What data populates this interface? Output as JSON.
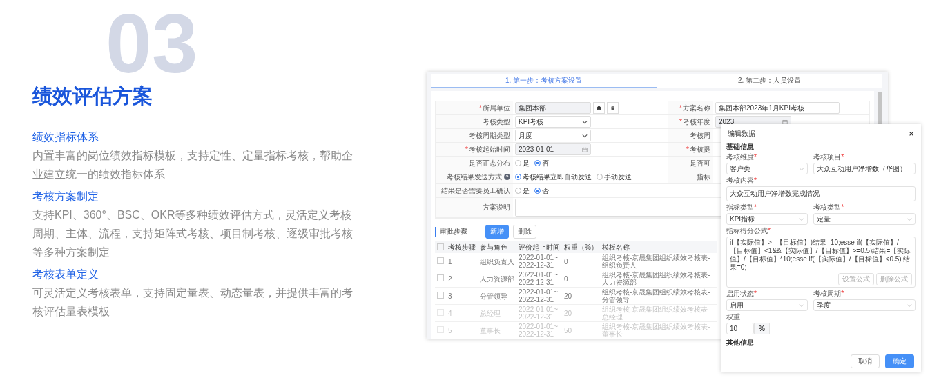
{
  "hero": {
    "number": "03",
    "title": "绩效评估方案"
  },
  "features": [
    {
      "heading": "绩效指标体系",
      "text": "内置丰富的岗位绩效指标模板，支持定性、定量指标考核，帮助企业建立统一的绩效指标体系"
    },
    {
      "heading": "考核方案制定",
      "text": "支持KPI、360°、BSC、OKR等多种绩效评估方式，灵活定义考核周期、主体、流程，支持矩阵式考核、项目制考核、逐级审批考核等多种方案制定"
    },
    {
      "heading": "考核表单定义",
      "text": "可灵活定义考核表单，支持固定量表、动态量表，并提供丰富的考核评估量表模板"
    }
  ],
  "app": {
    "steps": [
      {
        "label": "1. 第一步：考核方案设置",
        "selected": true
      },
      {
        "label": "2. 第二步：人员设置",
        "selected": false
      }
    ],
    "form_left": [
      {
        "asterisk": "*",
        "label": "所属单位",
        "kind": "unit",
        "value": "集团本部"
      },
      {
        "label": "考核类型",
        "kind": "select",
        "value": "KPI考核"
      },
      {
        "label": "考核周期类型",
        "kind": "select",
        "value": "月度"
      },
      {
        "asterisk": "*",
        "label": "考核起始时间",
        "kind": "date",
        "value": "2023-01-01"
      },
      {
        "label": "是否正态分布",
        "kind": "radio",
        "options": [
          {
            "label": "是",
            "selected": false
          },
          {
            "label": "否",
            "selected": true
          }
        ]
      },
      {
        "label": "考核结果发送方式",
        "help": true,
        "kind": "radio",
        "options": [
          {
            "label": "考核结果立即自动发送",
            "selected": true
          },
          {
            "label": "手动发送",
            "selected": false
          }
        ]
      },
      {
        "label": "结果是否需要员工确认",
        "kind": "radio",
        "options": [
          {
            "label": "是",
            "selected": false
          },
          {
            "label": "否",
            "selected": true
          }
        ]
      },
      {
        "label": "方案说明",
        "kind": "textarea"
      }
    ],
    "form_right": [
      {
        "asterisk": "*",
        "label": "方案名称",
        "kind": "input",
        "value": "集团本部2023年1月KPI考核"
      },
      {
        "asterisk": "*",
        "label": "考核年度",
        "kind": "date",
        "value": "2023"
      },
      {
        "label": "考核周",
        "kind": "label"
      },
      {
        "asterisk": "*",
        "label": "考核提",
        "kind": "label"
      },
      {
        "label": "是否可",
        "kind": "label"
      },
      {
        "label": "指标",
        "kind": "label"
      }
    ],
    "approval": {
      "title": "审批步骤",
      "buttons": [
        {
          "label": "新增",
          "primary": true
        },
        {
          "label": "删除",
          "primary": false
        }
      ],
      "header_checked": false,
      "columns": [
        "考核步骤",
        "参与角色",
        "评价起止时间",
        "权重（%）",
        "模板名称"
      ],
      "rows": [
        {
          "checked": false,
          "faded": false,
          "cells": [
            "1",
            "组织负责人",
            "2022-01-01~2022-12-31",
            "0",
            "组织考核-京晟集团组织绩效考核表-组织负责人"
          ]
        },
        {
          "checked": false,
          "faded": false,
          "cells": [
            "2",
            "人力资源部",
            "2022-01-01~2022-12-31",
            "0",
            "组织考核-京晟集团组织绩效考核表-人力资源部"
          ]
        },
        {
          "checked": false,
          "faded": false,
          "cells": [
            "3",
            "分管领导",
            "2022-01-01~2022-12-31",
            "20",
            "组织考核-京晟集团组织绩效考核表-分管领导"
          ]
        },
        {
          "checked": false,
          "faded": true,
          "cells": [
            "4",
            "总经理",
            "2022-01-01~2022-12-31",
            "20",
            "组织考核-京晟集团组织绩效考核表-总经理"
          ]
        },
        {
          "checked": false,
          "faded": true,
          "cells": [
            "5",
            "董事长",
            "2022-01-01~2022-12-31",
            "50",
            "组织考核-京晟集团组织绩效考核表-董事长"
          ]
        }
      ]
    }
  },
  "modal": {
    "title": "编辑数据",
    "section": "基础信息",
    "rows": [
      [
        {
          "label": "考核维度",
          "asterisk": "*",
          "kind": "select",
          "value": "客户类"
        },
        {
          "label": "考核项目",
          "asterisk": "*",
          "kind": "input",
          "value": "大众互动用户净增数（华图）"
        }
      ],
      [
        {
          "label": "考核内容",
          "asterisk": "*",
          "kind": "textarea",
          "value": "大众互动用户净增数完成情况"
        }
      ],
      [
        {
          "label": "指标类型",
          "asterisk": "*",
          "kind": "select",
          "value": "KPI指标"
        },
        {
          "label": "考核类型",
          "asterisk": "*",
          "kind": "select",
          "value": "定量"
        }
      ],
      [
        {
          "label": "指标得分公式",
          "asterisk": "*",
          "kind": "formula",
          "value": "if【实际值】>=【目标值】)结果=10;esse if(【实际值】/【目标值】<1&&【实际值】/【目标值】>=0.5)结果=【实际值】/【目标值】*10;esse if(【实际值】/【目标值】<0.5) 结果=0;",
          "buttons": [
            "设置公式",
            "删除公式"
          ]
        }
      ],
      [
        {
          "label": "启用状态",
          "asterisk": "*",
          "kind": "select",
          "value": "启用"
        },
        {
          "label": "考核周期",
          "asterisk": "*",
          "kind": "select",
          "value": "季度"
        }
      ],
      [
        {
          "label": "权重",
          "kind": "suffix",
          "value": "10",
          "suffix": "%"
        }
      ]
    ],
    "section_2": "其他信息",
    "buttons": [
      {
        "label": "取消",
        "primary": false
      },
      {
        "label": "确定",
        "primary": true
      }
    ]
  }
}
